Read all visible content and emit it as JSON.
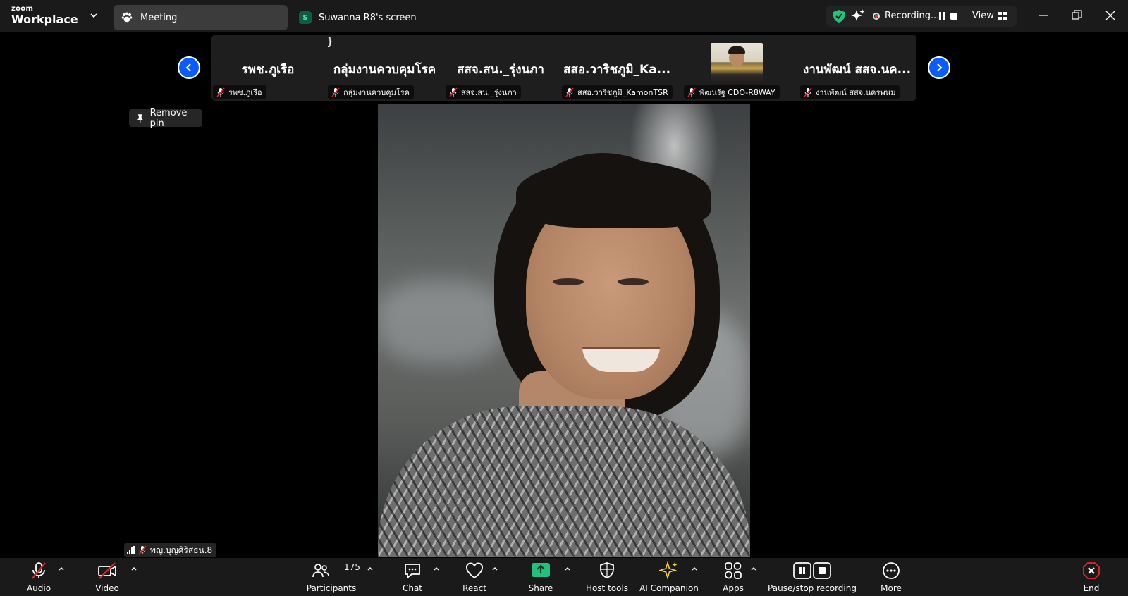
{
  "brand": {
    "top": "zoom",
    "name": "Workplace"
  },
  "tabs": [
    {
      "label": "Meeting"
    },
    {
      "label": "Suwanna R8's screen",
      "badge": "S"
    }
  ],
  "status": {
    "recording": "Recording...",
    "view": "View"
  },
  "strip": {
    "tiles": [
      {
        "big": "รพช.ภูเรือ",
        "label": "รพช.ภูเรือ"
      },
      {
        "big": "กลุ่มงานควบคุมโรค",
        "label": "กลุ่มงานควบคุมโรค"
      },
      {
        "big": "สสจ.สน._รุ่งนภา",
        "label": "สสจ.สน._รุ่งนภา"
      },
      {
        "big": "สสอ.วาริชภูมิ_Ka...",
        "label": "สสอ.วาริชภูมิ_KamonTSR"
      },
      {
        "big": "",
        "label": "พัฒนรัฐ CDO-R8WAY"
      },
      {
        "big": "งานพัฒน์ สสจ.นค...",
        "label": "งานพัฒน์ สสจ.นครพนม"
      }
    ]
  },
  "pin": {
    "label": "Remove pin"
  },
  "speaker": {
    "name": "พญ.บุญศิริสธน.8"
  },
  "toolbar": {
    "audio": "Audio",
    "video": "Video",
    "participants": "Participants",
    "participants_count": "175",
    "chat": "Chat",
    "react": "React",
    "share": "Share",
    "host_tools": "Host tools",
    "ai_companion": "AI Companion",
    "apps": "Apps",
    "pause_stop": "Pause/stop recording",
    "more": "More",
    "end": "End"
  },
  "colors": {
    "accent": "#0b5cff",
    "share_green": "#1fc37b",
    "muted_red": "#e02828",
    "end_red": "#e02828"
  },
  "icons": [
    "chevron-down-icon",
    "paw-icon",
    "shield-check-icon",
    "sparkle-icon",
    "record-icon",
    "pause-icon",
    "stop-icon",
    "grid-icon",
    "minimize-icon",
    "restore-icon",
    "close-icon",
    "mic-muted-icon",
    "video-off-icon",
    "participants-icon",
    "chat-icon",
    "heart-icon",
    "share-screen-icon",
    "host-shield-icon",
    "ai-sparkle-icon",
    "apps-icon",
    "more-icon",
    "end-icon",
    "pin-icon",
    "signal-icon"
  ]
}
